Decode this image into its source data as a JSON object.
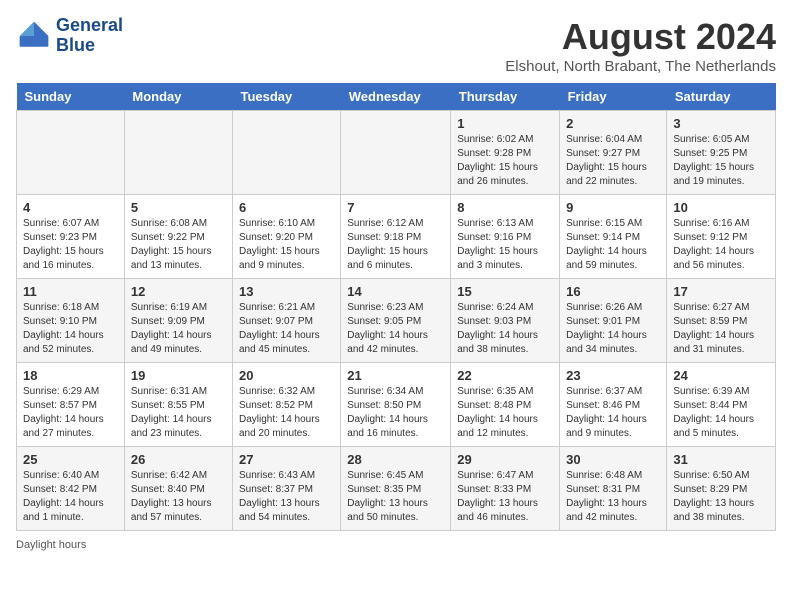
{
  "header": {
    "logo_line1": "General",
    "logo_line2": "Blue",
    "title": "August 2024",
    "subtitle": "Elshout, North Brabant, The Netherlands"
  },
  "days_of_week": [
    "Sunday",
    "Monday",
    "Tuesday",
    "Wednesday",
    "Thursday",
    "Friday",
    "Saturday"
  ],
  "weeks": [
    [
      {
        "day": "",
        "info": ""
      },
      {
        "day": "",
        "info": ""
      },
      {
        "day": "",
        "info": ""
      },
      {
        "day": "",
        "info": ""
      },
      {
        "day": "1",
        "info": "Sunrise: 6:02 AM\nSunset: 9:28 PM\nDaylight: 15 hours\nand 26 minutes."
      },
      {
        "day": "2",
        "info": "Sunrise: 6:04 AM\nSunset: 9:27 PM\nDaylight: 15 hours\nand 22 minutes."
      },
      {
        "day": "3",
        "info": "Sunrise: 6:05 AM\nSunset: 9:25 PM\nDaylight: 15 hours\nand 19 minutes."
      }
    ],
    [
      {
        "day": "4",
        "info": "Sunrise: 6:07 AM\nSunset: 9:23 PM\nDaylight: 15 hours\nand 16 minutes."
      },
      {
        "day": "5",
        "info": "Sunrise: 6:08 AM\nSunset: 9:22 PM\nDaylight: 15 hours\nand 13 minutes."
      },
      {
        "day": "6",
        "info": "Sunrise: 6:10 AM\nSunset: 9:20 PM\nDaylight: 15 hours\nand 9 minutes."
      },
      {
        "day": "7",
        "info": "Sunrise: 6:12 AM\nSunset: 9:18 PM\nDaylight: 15 hours\nand 6 minutes."
      },
      {
        "day": "8",
        "info": "Sunrise: 6:13 AM\nSunset: 9:16 PM\nDaylight: 15 hours\nand 3 minutes."
      },
      {
        "day": "9",
        "info": "Sunrise: 6:15 AM\nSunset: 9:14 PM\nDaylight: 14 hours\nand 59 minutes."
      },
      {
        "day": "10",
        "info": "Sunrise: 6:16 AM\nSunset: 9:12 PM\nDaylight: 14 hours\nand 56 minutes."
      }
    ],
    [
      {
        "day": "11",
        "info": "Sunrise: 6:18 AM\nSunset: 9:10 PM\nDaylight: 14 hours\nand 52 minutes."
      },
      {
        "day": "12",
        "info": "Sunrise: 6:19 AM\nSunset: 9:09 PM\nDaylight: 14 hours\nand 49 minutes."
      },
      {
        "day": "13",
        "info": "Sunrise: 6:21 AM\nSunset: 9:07 PM\nDaylight: 14 hours\nand 45 minutes."
      },
      {
        "day": "14",
        "info": "Sunrise: 6:23 AM\nSunset: 9:05 PM\nDaylight: 14 hours\nand 42 minutes."
      },
      {
        "day": "15",
        "info": "Sunrise: 6:24 AM\nSunset: 9:03 PM\nDaylight: 14 hours\nand 38 minutes."
      },
      {
        "day": "16",
        "info": "Sunrise: 6:26 AM\nSunset: 9:01 PM\nDaylight: 14 hours\nand 34 minutes."
      },
      {
        "day": "17",
        "info": "Sunrise: 6:27 AM\nSunset: 8:59 PM\nDaylight: 14 hours\nand 31 minutes."
      }
    ],
    [
      {
        "day": "18",
        "info": "Sunrise: 6:29 AM\nSunset: 8:57 PM\nDaylight: 14 hours\nand 27 minutes."
      },
      {
        "day": "19",
        "info": "Sunrise: 6:31 AM\nSunset: 8:55 PM\nDaylight: 14 hours\nand 23 minutes."
      },
      {
        "day": "20",
        "info": "Sunrise: 6:32 AM\nSunset: 8:52 PM\nDaylight: 14 hours\nand 20 minutes."
      },
      {
        "day": "21",
        "info": "Sunrise: 6:34 AM\nSunset: 8:50 PM\nDaylight: 14 hours\nand 16 minutes."
      },
      {
        "day": "22",
        "info": "Sunrise: 6:35 AM\nSunset: 8:48 PM\nDaylight: 14 hours\nand 12 minutes."
      },
      {
        "day": "23",
        "info": "Sunrise: 6:37 AM\nSunset: 8:46 PM\nDaylight: 14 hours\nand 9 minutes."
      },
      {
        "day": "24",
        "info": "Sunrise: 6:39 AM\nSunset: 8:44 PM\nDaylight: 14 hours\nand 5 minutes."
      }
    ],
    [
      {
        "day": "25",
        "info": "Sunrise: 6:40 AM\nSunset: 8:42 PM\nDaylight: 14 hours\nand 1 minute."
      },
      {
        "day": "26",
        "info": "Sunrise: 6:42 AM\nSunset: 8:40 PM\nDaylight: 13 hours\nand 57 minutes."
      },
      {
        "day": "27",
        "info": "Sunrise: 6:43 AM\nSunset: 8:37 PM\nDaylight: 13 hours\nand 54 minutes."
      },
      {
        "day": "28",
        "info": "Sunrise: 6:45 AM\nSunset: 8:35 PM\nDaylight: 13 hours\nand 50 minutes."
      },
      {
        "day": "29",
        "info": "Sunrise: 6:47 AM\nSunset: 8:33 PM\nDaylight: 13 hours\nand 46 minutes."
      },
      {
        "day": "30",
        "info": "Sunrise: 6:48 AM\nSunset: 8:31 PM\nDaylight: 13 hours\nand 42 minutes."
      },
      {
        "day": "31",
        "info": "Sunrise: 6:50 AM\nSunset: 8:29 PM\nDaylight: 13 hours\nand 38 minutes."
      }
    ]
  ],
  "legend": {
    "daylight_label": "Daylight hours"
  }
}
